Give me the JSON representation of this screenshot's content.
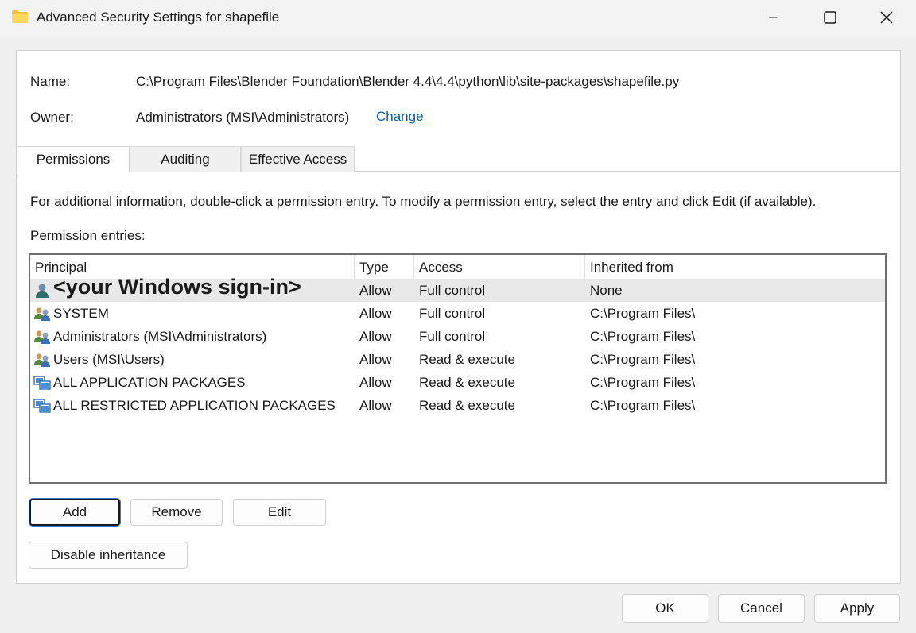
{
  "window": {
    "title": "Advanced Security Settings for shapefile"
  },
  "fields": {
    "name_label": "Name:",
    "name_value": "C:\\Program Files\\Blender Foundation\\Blender 4.4\\4.4\\python\\lib\\site-packages\\shapefile.py",
    "owner_label": "Owner:",
    "owner_value": "Administrators (MSI\\Administrators)",
    "change_link": "Change"
  },
  "tabs": [
    {
      "label": "Permissions",
      "active": true
    },
    {
      "label": "Auditing",
      "active": false
    },
    {
      "label": "Effective Access",
      "active": false
    }
  ],
  "info_text": "For additional information, double-click a permission entry. To modify a permission entry, select the entry and click Edit (if available).",
  "entries_label": "Permission entries:",
  "columns": [
    "Principal",
    "Type",
    "Access",
    "Inherited from"
  ],
  "entries": [
    {
      "principal": "<your Windows sign-in>",
      "icon": "user-icon",
      "type": "Allow",
      "access": "Full control",
      "inherited": "None"
    },
    {
      "principal": "SYSTEM",
      "icon": "group-icon",
      "type": "Allow",
      "access": "Full control",
      "inherited": "C:\\Program Files\\"
    },
    {
      "principal": "Administrators (MSI\\Administrators)",
      "icon": "group-icon",
      "type": "Allow",
      "access": "Full control",
      "inherited": "C:\\Program Files\\"
    },
    {
      "principal": "Users (MSI\\Users)",
      "icon": "group-icon",
      "type": "Allow",
      "access": "Read & execute",
      "inherited": "C:\\Program Files\\"
    },
    {
      "principal": "ALL APPLICATION PACKAGES",
      "icon": "app-packages-icon",
      "type": "Allow",
      "access": "Read & execute",
      "inherited": "C:\\Program Files\\"
    },
    {
      "principal": "ALL RESTRICTED APPLICATION PACKAGES",
      "icon": "app-packages-icon",
      "type": "Allow",
      "access": "Read & execute",
      "inherited": "C:\\Program Files\\"
    }
  ],
  "buttons": {
    "add": "Add",
    "remove": "Remove",
    "edit": "Edit",
    "disable_inheritance": "Disable inheritance",
    "ok": "OK",
    "cancel": "Cancel",
    "apply": "Apply"
  }
}
